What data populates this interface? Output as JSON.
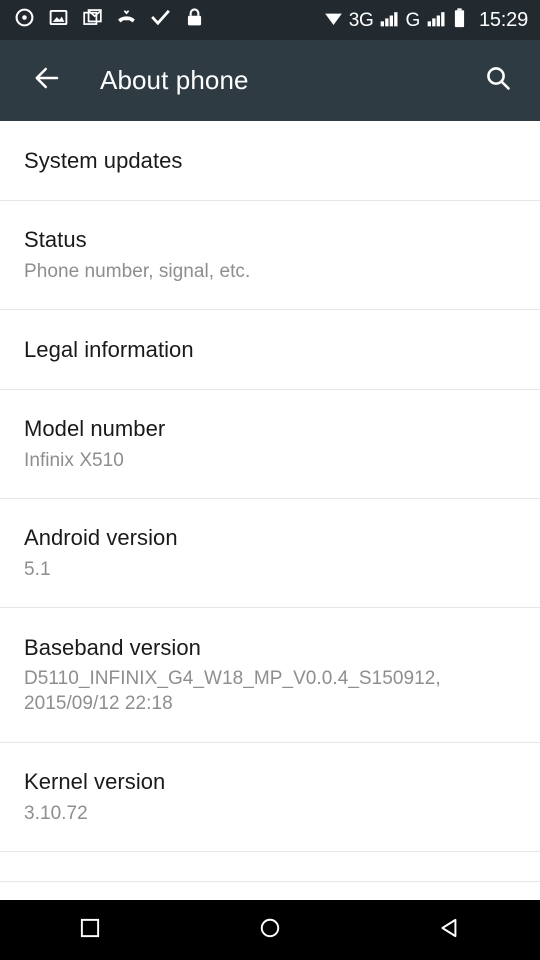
{
  "statusbar": {
    "time": "15:29",
    "network_1": "3G",
    "network_2": "G",
    "left_icons": [
      {
        "name": "disc-icon"
      },
      {
        "name": "image-icon"
      },
      {
        "name": "gmail-icon"
      },
      {
        "name": "missed-call-icon"
      },
      {
        "name": "checkmark-icon"
      },
      {
        "name": "lock-icon"
      }
    ],
    "right_icons": [
      {
        "name": "wifi-icon"
      },
      {
        "name": "signal-bars-icon"
      },
      {
        "name": "signal-bars-2-icon"
      },
      {
        "name": "battery-icon"
      }
    ],
    "background": "#222a30"
  },
  "appbar": {
    "title": "About phone",
    "back_icon": "arrow-left-icon",
    "search_icon": "search-icon",
    "background": "#2e3b43"
  },
  "list": [
    {
      "title": "System updates",
      "subtitle": "",
      "lines": 1
    },
    {
      "title": "Status",
      "subtitle": "Phone number, signal, etc.",
      "lines": 2
    },
    {
      "title": "Legal information",
      "subtitle": "",
      "lines": 1
    },
    {
      "title": "Model number",
      "subtitle": "Infinix X510",
      "lines": 2
    },
    {
      "title": "Android version",
      "subtitle": "5.1",
      "lines": 2
    },
    {
      "title": "Baseband version",
      "subtitle": "D5110_INFINIX_G4_W18_MP_V0.0.4_S150912,\n2015/09/12 22:18",
      "lines": 3
    },
    {
      "title": "Kernel version",
      "subtitle": "3.10.72",
      "lines": 2
    }
  ],
  "navbar": {
    "recents_icon": "square-recents-icon",
    "home_icon": "circle-home-icon",
    "back_icon": "triangle-back-icon",
    "background": "#000000"
  },
  "colors": {
    "title_text": "#1a1a1a",
    "subtitle_text": "#8e8e8e",
    "divider": "#e6e6e6",
    "surface": "#ffffff"
  }
}
